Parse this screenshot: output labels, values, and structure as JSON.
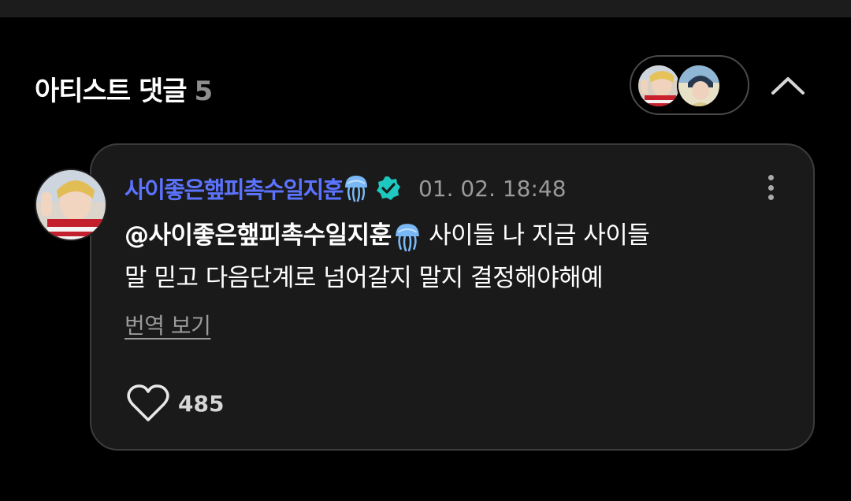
{
  "header": {
    "title": "아티스트 댓글",
    "count": "5"
  },
  "comment": {
    "author": "사이좋은햎피촉수일지훈",
    "timestamp": "01. 02. 18:48",
    "mention": "@사이좋은햎피촉수일지훈",
    "text_line1": " 사이들 나 지금 사이들",
    "text_line2": "말 믿고 다음단계로 넘어갈지 말지 결정해야해예",
    "translate_label": "번역 보기",
    "like_count": "485"
  },
  "icons": {
    "collapse": "chevron-up-icon",
    "verified": "verified-badge-icon",
    "emoji": "jellyfish-emoji",
    "more": "more-vertical-icon",
    "like": "heart-outline-icon"
  },
  "colors": {
    "background": "#000000",
    "card": "#1a1a1a",
    "author_name": "#5b73ff",
    "verified_badge": "#1ec8c0",
    "muted_text": "#9a9a9a"
  }
}
